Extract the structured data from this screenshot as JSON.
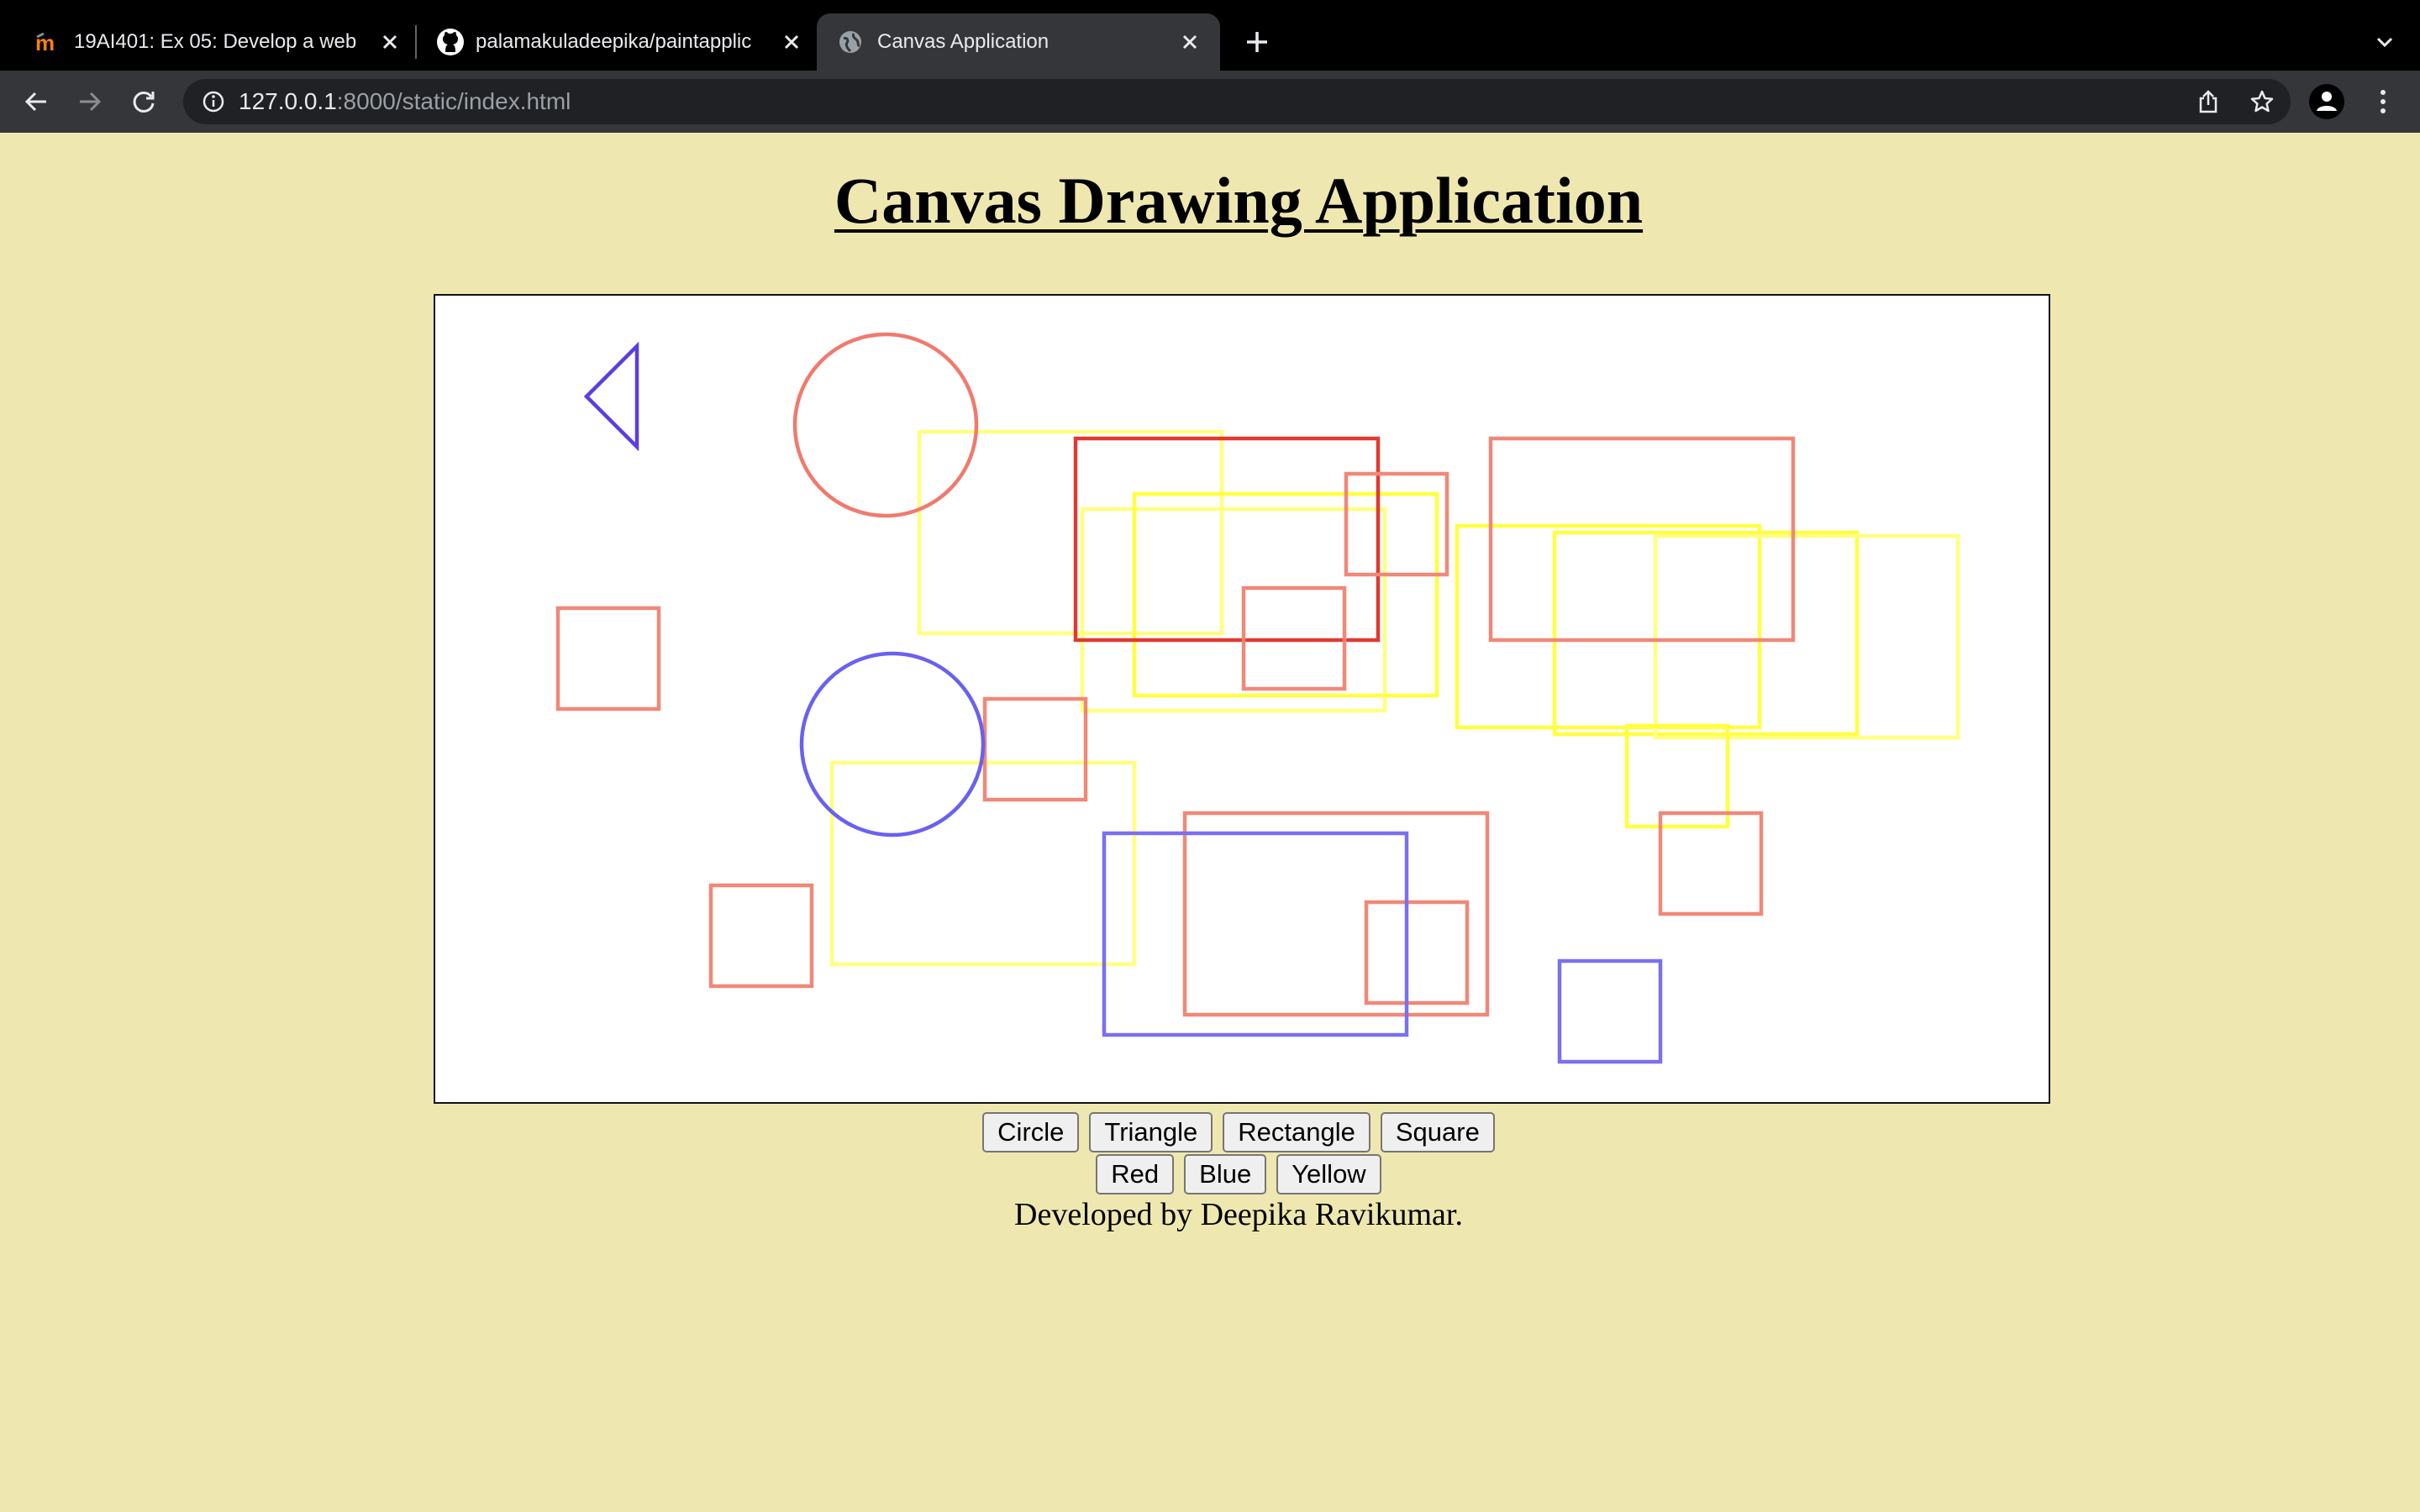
{
  "browser": {
    "tabs": [
      {
        "title": "19AI401: Ex 05: Develop a web",
        "icon": "moodle-icon",
        "active": false
      },
      {
        "title": "palamakuladeepika/paintapplic",
        "icon": "github-icon",
        "active": false
      },
      {
        "title": "Canvas Application",
        "icon": "globe-icon",
        "active": true
      }
    ],
    "url_host": "127.0.0.1",
    "url_rest": ":8000/static/index.html"
  },
  "page": {
    "heading": "Canvas Drawing Application",
    "shape_buttons": [
      "Circle",
      "Triangle",
      "Rectangle",
      "Square"
    ],
    "color_buttons": [
      "Red",
      "Blue",
      "Yellow"
    ],
    "credit": "Developed by Deepika Ravikumar."
  },
  "colors": {
    "page_background": "#eee8b0",
    "red_stroke": "#f08878",
    "red_strong": "#e03a30",
    "blue_stroke": "#6a60f0",
    "triangle_stroke": "#5a3ee0",
    "yellow_stroke": "#ffff40"
  }
}
